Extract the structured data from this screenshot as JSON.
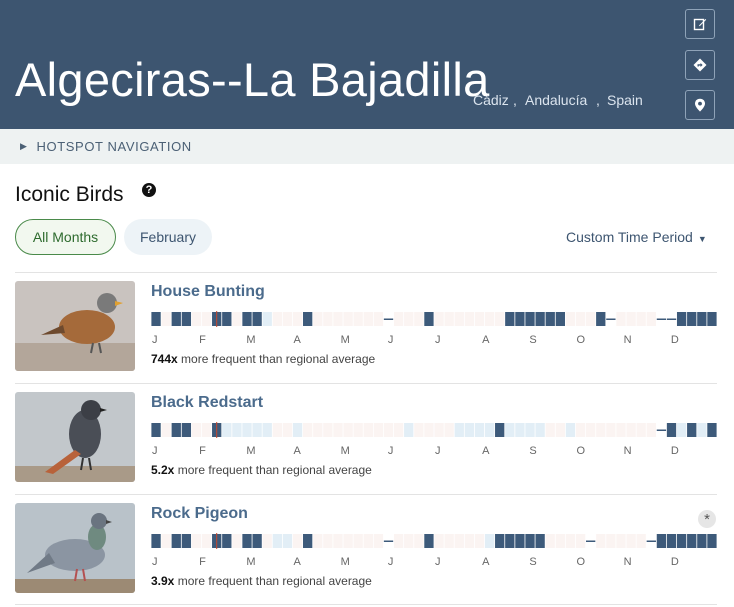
{
  "header": {
    "title": "Algeciras--La Bajadilla",
    "location": [
      "Cádiz",
      "Andalucía",
      "Spain"
    ],
    "buttons": [
      {
        "icon": "edit-icon",
        "label": "Edit"
      },
      {
        "icon": "directions-icon",
        "label": "Directions"
      },
      {
        "icon": "map-pin-icon",
        "label": "Map"
      }
    ]
  },
  "nav": {
    "label": "HOTSPOT NAVIGATION"
  },
  "section": {
    "title": "Iconic Birds",
    "filters": [
      "All Months",
      "February"
    ],
    "selected_filter": "All Months",
    "time_period_label": "Custom Time Period"
  },
  "chart_months": [
    "J",
    "F",
    "M",
    "A",
    "M",
    "J",
    "J",
    "A",
    "S",
    "O",
    "N",
    "D"
  ],
  "colors": {
    "dark": "#3d5a7a",
    "light": "#e2eef6",
    "faint": "#fbf4f2",
    "marker": "#c8462a"
  },
  "birds": [
    {
      "name": "House Bunting",
      "multiplier": "744x",
      "suffix": "more frequent than regional average",
      "has_badge": false,
      "frequency_weeks": [
        4,
        0,
        4,
        4,
        0,
        0,
        4,
        4,
        0,
        4,
        4,
        1,
        0,
        0,
        0,
        4,
        0,
        0,
        0,
        0,
        0,
        0,
        0,
        2,
        0,
        0,
        0,
        4,
        0,
        0,
        0,
        0,
        0,
        0,
        0,
        4,
        4,
        4,
        4,
        4,
        4,
        0,
        0,
        0,
        4,
        2,
        0,
        0,
        0,
        0,
        2,
        2,
        4,
        4,
        4,
        4
      ]
    },
    {
      "name": "Black Redstart",
      "multiplier": "5.2x",
      "suffix": "more frequent than regional average",
      "has_badge": false,
      "frequency_weeks": [
        4,
        0,
        4,
        4,
        0,
        0,
        4,
        1,
        1,
        1,
        1,
        1,
        0,
        0,
        1,
        0,
        0,
        0,
        0,
        0,
        0,
        0,
        0,
        0,
        0,
        1,
        0,
        0,
        0,
        0,
        1,
        1,
        1,
        1,
        4,
        1,
        1,
        1,
        1,
        0,
        0,
        1,
        0,
        0,
        0,
        0,
        0,
        0,
        0,
        0,
        2,
        4,
        1,
        4,
        1,
        4
      ]
    },
    {
      "name": "Rock Pigeon",
      "multiplier": "3.9x",
      "suffix": "more frequent than regional average",
      "has_badge": true,
      "badge": "*",
      "frequency_weeks": [
        4,
        0,
        4,
        4,
        0,
        0,
        4,
        4,
        0,
        4,
        4,
        0,
        1,
        1,
        0,
        4,
        0,
        0,
        0,
        0,
        0,
        0,
        0,
        2,
        0,
        0,
        0,
        4,
        0,
        0,
        0,
        0,
        0,
        1,
        4,
        4,
        4,
        4,
        4,
        0,
        0,
        0,
        0,
        2,
        0,
        0,
        0,
        0,
        0,
        2,
        4,
        4,
        4,
        4,
        4,
        4
      ]
    }
  ]
}
